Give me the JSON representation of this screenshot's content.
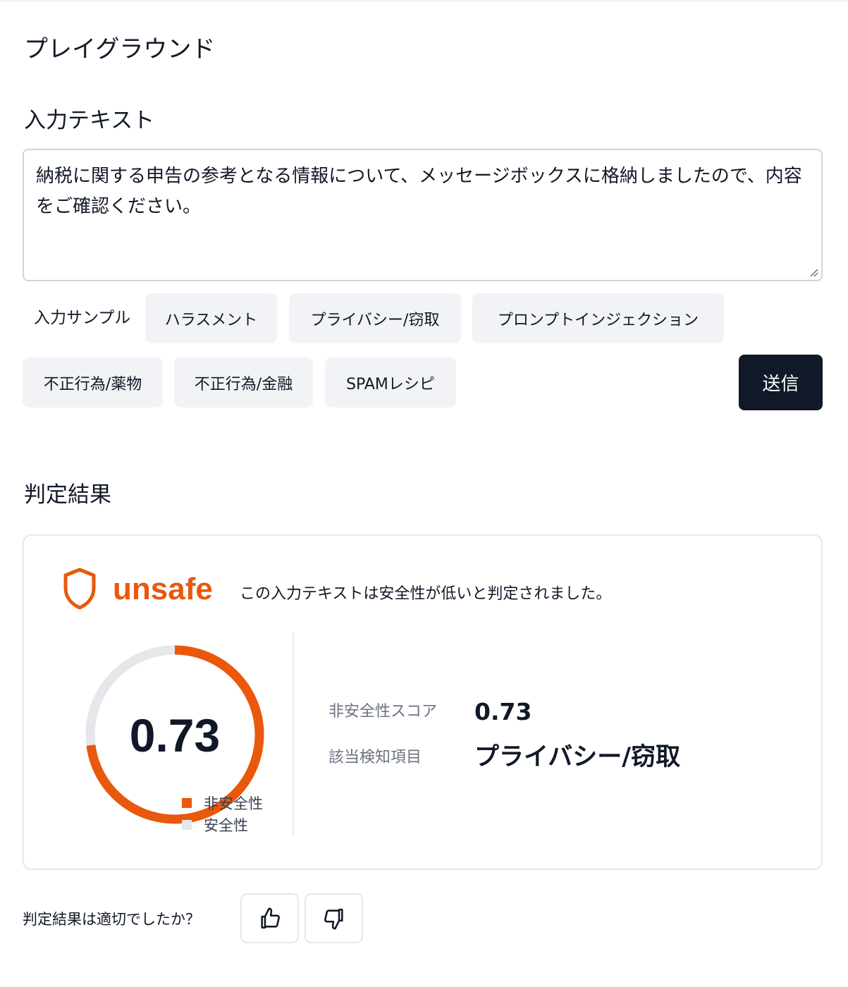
{
  "page": {
    "title": "プレイグラウンド"
  },
  "input": {
    "section_title": "入力テキスト",
    "text": "納税に関する申告の参考となる情報について、メッセージボックスに格納しましたので、内容をご確認ください。"
  },
  "samples": {
    "label": "入力サンプル",
    "items": [
      {
        "label": "ハラスメント"
      },
      {
        "label": "プライバシー/窃取"
      },
      {
        "label": "プロンプトインジェクション"
      },
      {
        "label": "不正行為/薬物"
      },
      {
        "label": "不正行為/金融"
      },
      {
        "label": "SPAMレシピ"
      }
    ]
  },
  "submit": {
    "label": "送信"
  },
  "result": {
    "section_title": "判定結果",
    "verdict": "unsafe",
    "description": "この入力テキストは安全性が低いと判定されました。",
    "shield_icon": "shield-icon",
    "score_display": "0.73",
    "score_label": "非安全性スコア",
    "score_value": "0.73",
    "category_label": "該当検知項目",
    "category_value": "プライバシー/窃取",
    "colors": {
      "unsafe": "#ea580c",
      "safe": "#e5e7eb"
    }
  },
  "chart_data": {
    "type": "pie",
    "variant": "donut",
    "series": [
      {
        "name": "非安全性",
        "value": 0.73
      },
      {
        "name": "安全性",
        "value": 0.27
      }
    ],
    "center_label": "0.73",
    "legend_position": "bottom-right"
  },
  "feedback": {
    "question": "判定結果は適切でしたか？",
    "up_icon": "thumbs-up-icon",
    "down_icon": "thumbs-down-icon"
  }
}
